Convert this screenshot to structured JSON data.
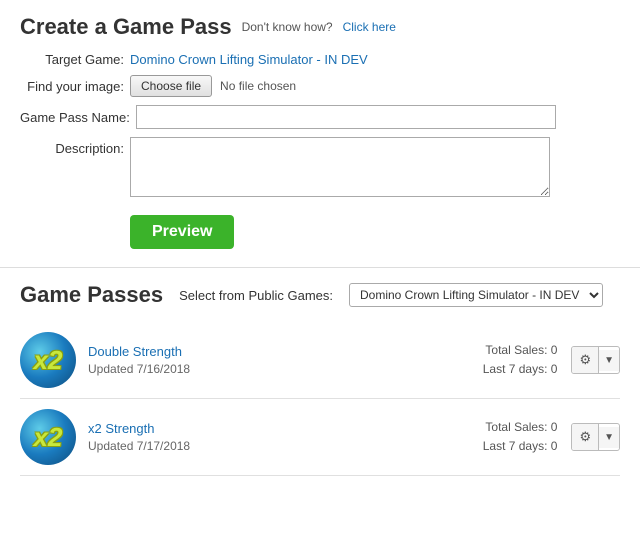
{
  "create_section": {
    "title": "Create a Game Pass",
    "dont_know_text": "Don't know how?",
    "click_here_label": "Click here",
    "target_game_label": "Target Game:",
    "target_game_value": "Domino Crown Lifting Simulator - IN DEV",
    "find_image_label": "Find your image:",
    "choose_file_label": "Choose file",
    "no_file_text": "No file chosen",
    "pass_name_label": "Game Pass Name:",
    "description_label": "Description:",
    "preview_button": "Preview"
  },
  "game_passes_section": {
    "title": "Game Passes",
    "select_from_label": "Select from Public Games:",
    "select_value": "Domino Crown Lifting Simulator - IN DEV ▼",
    "select_options": [
      "Domino Crown Lifting Simulator - IN DEV"
    ],
    "items": [
      {
        "name": "Double Strength",
        "updated": "Updated 7/16/2018",
        "total_sales_label": "Total Sales:",
        "total_sales_value": "0",
        "last7_label": "Last 7 days:",
        "last7_value": "0",
        "badge": "x2"
      },
      {
        "name": "x2 Strength",
        "updated": "Updated 7/17/2018",
        "total_sales_label": "Total Sales:",
        "total_sales_value": "0",
        "last7_label": "Last 7 days:",
        "last7_value": "0",
        "badge": "x2"
      }
    ]
  }
}
